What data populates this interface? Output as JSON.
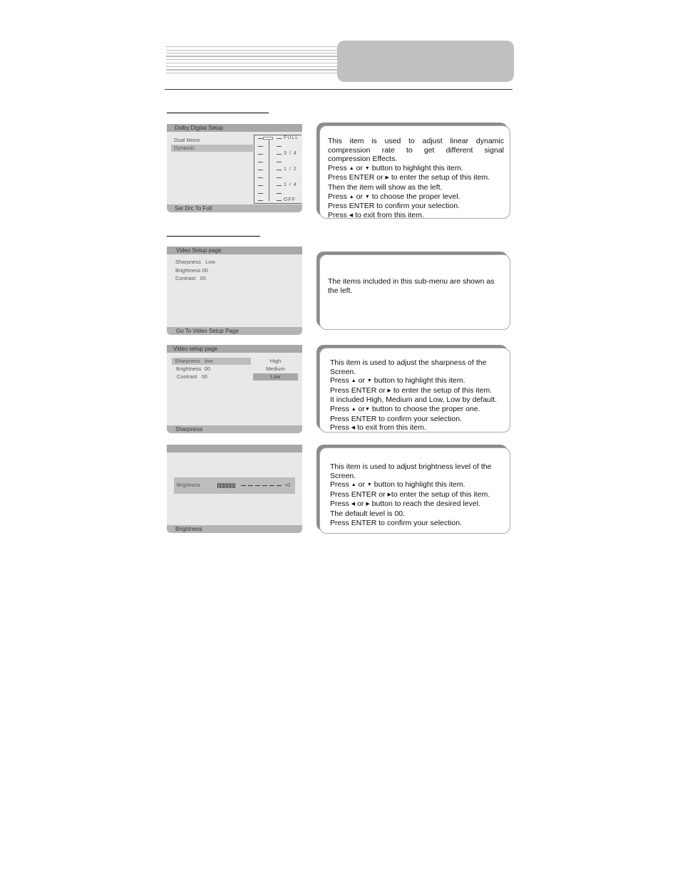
{
  "header": {
    "tab_label": ""
  },
  "sections": [
    {
      "osd": {
        "title": "Dolby Digital Setup",
        "items": [
          "Dual Mono",
          "Dynamic"
        ],
        "selected_index": 1,
        "status": "Set Drc To Full",
        "scale_labels": [
          "FULL",
          "3 / 4",
          "1 / 2",
          "1 / 4",
          "OFF"
        ],
        "scale_value": "FULL"
      },
      "info": {
        "lines": [
          "This item is used to adjust linear dynamic",
          "compression rate to get different signal",
          "compression Effects.",
          "Press ▲ or ▼ button to highlight this item.",
          "Press ENTER or ▶ to enter the setup of this item.",
          "Then the item will show as the left.",
          "Press ▲ or ▼ to choose the proper level.",
          "Press ENTER to confirm your selection.",
          "Press ◀ to exit from this item."
        ]
      }
    },
    {
      "osd": {
        "title": "Video Setup page",
        "items": [
          "Sharpness   Low",
          "Brightness 00",
          "Contrast   00"
        ],
        "status": "Go To Video Setup Page"
      },
      "info": {
        "lines": [
          "The items included in this sub-menu are shown as",
          "the left."
        ]
      }
    },
    {
      "osd": {
        "title": "Video setup page",
        "items": [
          "Sharpness   low",
          "Brightness  00",
          "Contrast   00"
        ],
        "selected_index": 0,
        "options": [
          "High",
          "Medium",
          "Low"
        ],
        "selected_option": "Low",
        "status": "Sharpness"
      },
      "info": {
        "lines": [
          "This item is used to adjust the sharpness of the",
          "Screen.",
          "Press ▲ or ▼ button to highlight this item.",
          "Press ENTER or ▶ to enter the setup of this item.",
          "It included High, Medium and Low, Low by default.",
          "Press ▲ or▼ button to choose the proper one.",
          "Press ENTER to confirm your selection.",
          "Press ◀ to exit from this item."
        ]
      }
    },
    {
      "osd": {
        "title": "",
        "slider_label": "Brightness",
        "slider_value_text": "+0",
        "slider_value": 0,
        "status": "Brightness"
      },
      "info": {
        "lines": [
          "This item is used to adjust brightness level of the",
          "Screen.",
          "Press ▲ or ▼ button to highlight this item.",
          "Press ENTER or ▶to enter the setup of this item.",
          "Press ◀ or ▶ button to reach the desired level.",
          "The default level is 00.",
          "Press ENTER to confirm your selection."
        ]
      }
    }
  ]
}
